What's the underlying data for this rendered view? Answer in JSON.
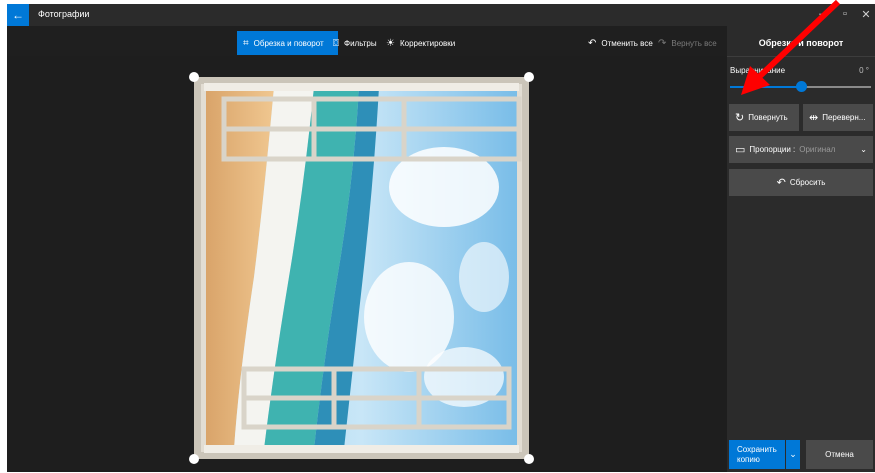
{
  "app": {
    "title": "Фотографии",
    "back_icon": "back-arrow-icon",
    "window_controls": [
      "minimize",
      "restore",
      "close"
    ]
  },
  "toolbar": {
    "crop_rotate": "Обрезка и поворот",
    "filters": "Фильтры",
    "adjustments": "Корректировки",
    "undo_all": "Отменить все",
    "redo_all": "Вернуть все"
  },
  "panel": {
    "title": "Обрезка и поворот",
    "straighten_label": "Выравнивание",
    "straighten_value": "0 °",
    "straighten_fraction": 0.5,
    "rotate_label": "Повернуть",
    "flip_label": "Переверн...",
    "aspect_label": "Пропорции :",
    "aspect_value": "Оригинал",
    "reset_label": "Сбросить",
    "save_label": "Сохранить копию",
    "cancel_label": "Отмена"
  },
  "colors": {
    "accent": "#0078d7",
    "panel_bg": "#2b2b2b",
    "canvas_bg": "#1e1e1e",
    "annotation_arrow": "#ff0000"
  }
}
